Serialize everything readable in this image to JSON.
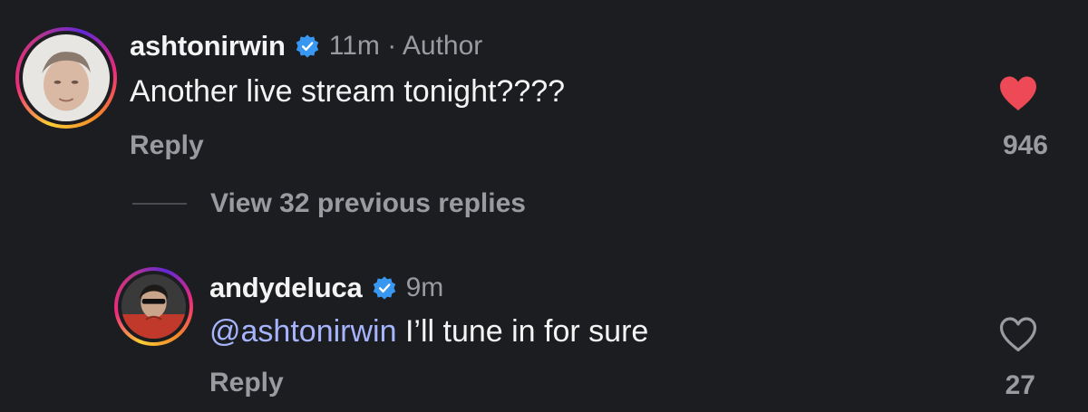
{
  "comments": [
    {
      "username": "ashtonirwin",
      "verified": true,
      "meta": "11m · Author",
      "text": "Another live stream tonight????",
      "reply_label": "Reply",
      "like_count": "946",
      "liked": true
    },
    {
      "username": "andydeluca",
      "verified": true,
      "meta": "9m",
      "mention": "@ashtonirwin",
      "text": " I’ll tune in for sure",
      "reply_label": "Reply",
      "like_count": "27",
      "liked": false
    }
  ],
  "view_replies_label": "View 32 previous replies",
  "colors": {
    "background": "#1c1d21",
    "verified": "#3897f0",
    "liked_heart": "#ed4956",
    "mention": "#a5b4fc",
    "secondary_text": "#9a9ba0"
  },
  "icons": [
    "verified-badge-icon",
    "heart-filled-icon",
    "heart-outline-icon"
  ]
}
